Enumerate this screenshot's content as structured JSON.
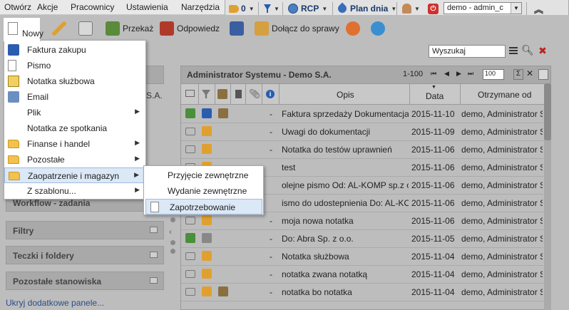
{
  "menubar": {
    "items": [
      "Otwórz",
      "Akcje",
      "Pracownicy",
      "Ustawienia",
      "Narzędzia"
    ]
  },
  "topbar": {
    "count": "0",
    "rcp": "RCP",
    "plan": "Plan dnia",
    "user": "demo - admin_c"
  },
  "toolbar": {
    "nowy": "Nowy",
    "przekaz": "Przekaż",
    "odpowiedz": "Odpowiedz",
    "dolacz": "Dołącz do sprawy"
  },
  "search": {
    "placeholder": "Wyszukaj"
  },
  "menu": {
    "items": [
      {
        "label": "Faktura zakupu",
        "icon": "invoice-icon",
        "arrow": false
      },
      {
        "label": "Pismo",
        "icon": "document-icon",
        "arrow": false
      },
      {
        "label": "Notatka służbowa",
        "icon": "note-icon",
        "arrow": false
      },
      {
        "label": "Email",
        "icon": "email-icon",
        "arrow": false
      },
      {
        "label": "Plik",
        "icon": "",
        "arrow": true
      },
      {
        "label": "Notatka ze spotkania",
        "icon": "",
        "arrow": false
      },
      {
        "label": "Finanse i handel",
        "icon": "folder-icon",
        "arrow": true
      },
      {
        "label": "Pozostałe",
        "icon": "folder-icon",
        "arrow": true
      },
      {
        "label": "Zaopatrzenie i magazyn",
        "icon": "folder-icon",
        "arrow": true
      },
      {
        "label": "Z szablonu...",
        "icon": "",
        "arrow": true
      }
    ],
    "arrow_glyph": "▶"
  },
  "submenu": {
    "items": [
      "Przyjęcie zewnętrzne",
      "Wydanie zewnętrzne",
      "Zapotrzebowanie"
    ]
  },
  "left": {
    "sa_label": "S.A.",
    "panels": [
      "Workflow - zadania",
      "Filtry",
      "Teczki i foldery",
      "Pozostałe stanowiska"
    ],
    "hide_link": "Ukryj dodatkowe panele..."
  },
  "grid": {
    "title": "Administrator Systemu - Demo S.A.",
    "range": "1-100",
    "page_size": "100",
    "columns": {
      "opis": "Opis",
      "data": "Data",
      "otrzymane": "Otrzymane od"
    },
    "rows": [
      {
        "dash": "-",
        "opis": "Faktura sprzedaży Dokumentacja pro",
        "data": "2015-11-10",
        "od": "demo, Administrator Sys"
      },
      {
        "dash": "-",
        "opis": "Uwagi do dokumentacji",
        "data": "2015-11-09",
        "od": "demo, Administrator Sys"
      },
      {
        "dash": "-",
        "opis": "Notatka do testów uprawnień",
        "data": "2015-11-06",
        "od": "demo, Administrator Sys"
      },
      {
        "dash": "",
        "opis": "test",
        "data": "2015-11-06",
        "od": "demo, Administrator Sys"
      },
      {
        "dash": "",
        "opis": "olejne pismo Od: AL-KOMP sp.z o.o",
        "data": "2015-11-06",
        "od": "demo, Administrator Sys"
      },
      {
        "dash": "",
        "opis": "ismo do udostepnienia Do: AL-KOM",
        "data": "2015-11-06",
        "od": "demo, Administrator Sys"
      },
      {
        "dash": "-",
        "opis": "moja nowa notatka",
        "data": "2015-11-06",
        "od": "demo, Administrator Sys"
      },
      {
        "dash": "-",
        "opis": "Do: Abra Sp. z o.o.",
        "data": "2015-11-05",
        "od": "demo, Administrator Sys"
      },
      {
        "dash": "-",
        "opis": "Notatka służbowa",
        "data": "2015-11-04",
        "od": "demo, Administrator Sys"
      },
      {
        "dash": "-",
        "opis": "notatka zwana notatką",
        "data": "2015-11-04",
        "od": "demo, Administrator Sys"
      },
      {
        "dash": "-",
        "opis": "notatka bo notatka",
        "data": "2015-11-04",
        "od": "demo, Administrator Sys"
      }
    ]
  }
}
